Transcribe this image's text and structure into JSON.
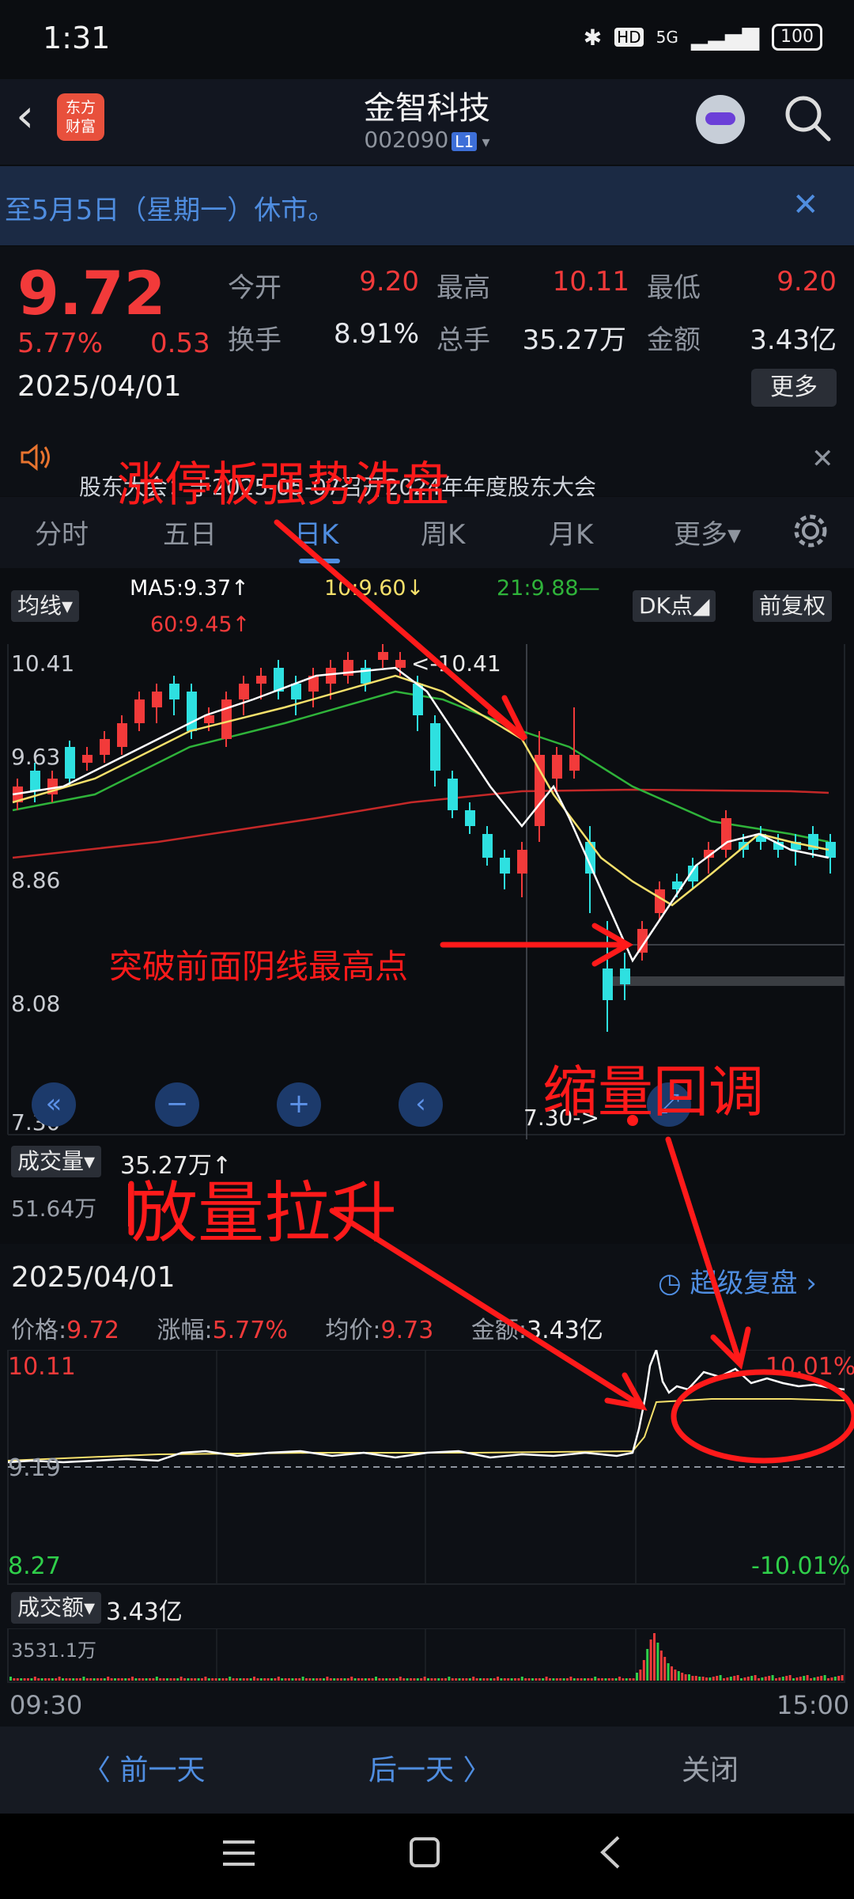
{
  "status": {
    "time": "1:31",
    "network": "5G",
    "hd": "HD",
    "battery": "100"
  },
  "header": {
    "title": "金智科技",
    "code": "002090",
    "code_badge": "L1",
    "logo_line1": "东方",
    "logo_line2": "财富"
  },
  "notice": {
    "text": "至5月5日（星期一）休市。"
  },
  "quote": {
    "price": "9.72",
    "change_pct": "5.77%",
    "change": "0.53",
    "date": "2025/04/01",
    "open_label": "今开",
    "open": "9.20",
    "high_label": "最高",
    "high": "10.11",
    "low_label": "最低",
    "low": "9.20",
    "turnover_label": "换手",
    "turnover": "8.91%",
    "volume_label": "总手",
    "volume": "35.27万",
    "amount_label": "金额",
    "amount": "3.43亿",
    "more": "更多"
  },
  "announcement": {
    "text": "股东大会：于2025-05-07召开2024年年度股东大会"
  },
  "tabs": {
    "fenshi": "分时",
    "wuri": "五日",
    "rik": "日K",
    "zhouk": "周K",
    "yuek": "月K",
    "more": "更多▾"
  },
  "kline": {
    "ma_select": "均线▾",
    "ma5": "MA5:9.37↑",
    "ma10": "10:9.60↓",
    "ma21": "21:9.88—",
    "ma60": "60:9.45↑",
    "dk": "DK点◢",
    "adj": "前复权",
    "y_labels": [
      "10.41",
      "9.63",
      "8.86",
      "8.08",
      "7.30"
    ],
    "max_marker": "<-10.41",
    "min_marker": "7.30->"
  },
  "volume": {
    "select": "成交量▾",
    "value": "35.27万↑",
    "axis": "51.64万"
  },
  "intraday": {
    "date": "2025/04/01",
    "replay": "超级复盘",
    "price_label": "价格:",
    "price": "9.72",
    "pct_label": "涨幅:",
    "pct": "5.77%",
    "avg_label": "均价:",
    "avg": "9.73",
    "amt_label": "金额:",
    "amt": "3.43亿",
    "top": "10.11",
    "mid": "9.19",
    "bottom": "8.27",
    "top_pct": "10.01%",
    "bottom_pct": "-10.01%",
    "amount_select": "成交额▾",
    "amount_value": "3.43亿",
    "amount_axis": "3531.1万",
    "time_start": "09:30",
    "time_end": "15:00"
  },
  "bottom_nav": {
    "prev": "〈 前一天",
    "next": "后一天 〉",
    "close": "关闭"
  },
  "annotations": {
    "a1": "涨停板强势洗盘",
    "a2": "突破前面阴线最高点",
    "a3": "缩量回调",
    "a4": "放量拉升"
  },
  "colors": {
    "up": "#f23a3a",
    "down": "#2ee0e0",
    "accent": "#4f8de0",
    "ma5": "#ffffff",
    "ma10": "#f5e06b",
    "ma21": "#2fb33a",
    "ma60": "#c42828"
  }
}
